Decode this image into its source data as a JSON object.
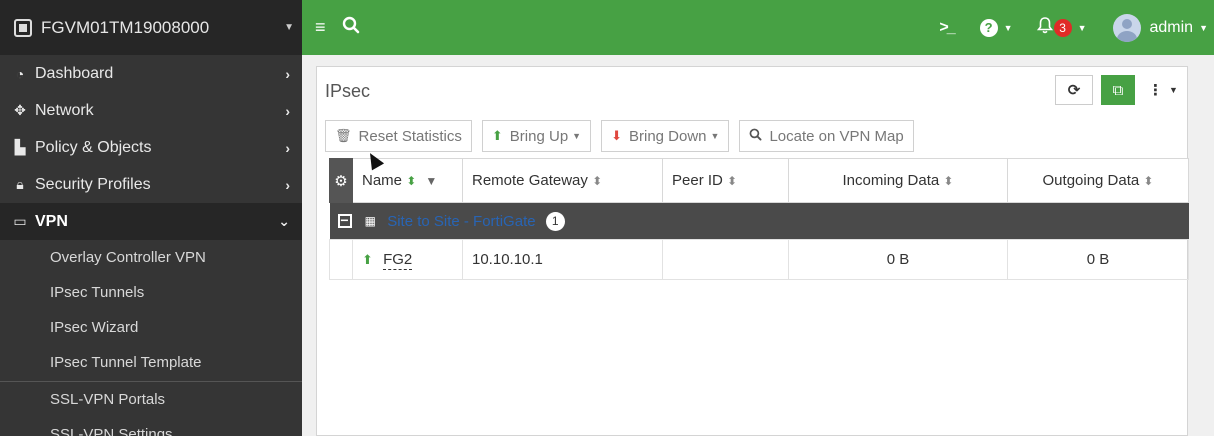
{
  "sidebar": {
    "device_name": "FGVM01TM19008000",
    "items": [
      {
        "label": "Dashboard",
        "icon": "dashboard-icon"
      },
      {
        "label": "Network",
        "icon": "network-icon"
      },
      {
        "label": "Policy & Objects",
        "icon": "policy-icon"
      },
      {
        "label": "Security Profiles",
        "icon": "lock-icon"
      },
      {
        "label": "VPN",
        "icon": "laptop-icon"
      }
    ],
    "vpn_subitems": [
      "Overlay Controller VPN",
      "IPsec Tunnels",
      "IPsec Wizard",
      "IPsec Tunnel Template",
      "SSL-VPN Portals",
      "SSL-VPN Settings"
    ]
  },
  "topbar": {
    "notification_count": "3",
    "username": "admin"
  },
  "panel": {
    "title": "IPsec",
    "toolbar": {
      "reset_stats": "Reset Statistics",
      "bring_up": "Bring Up",
      "bring_down": "Bring Down",
      "locate": "Locate on VPN Map"
    },
    "columns": {
      "name": "Name",
      "remote_gateway": "Remote Gateway",
      "peer_id": "Peer ID",
      "incoming": "Incoming Data",
      "outgoing": "Outgoing Data"
    },
    "group": {
      "label": "Site to Site - FortiGate",
      "count": "1"
    },
    "rows": [
      {
        "name": "FG2",
        "remote_gateway": "10.10.10.1",
        "peer_id": "",
        "incoming": "0 B",
        "outgoing": "0 B"
      }
    ]
  },
  "colors": {
    "accent": "#47a144",
    "sidebar": "#353535",
    "group_row": "#4a4a4a",
    "notification": "#e02b27"
  }
}
